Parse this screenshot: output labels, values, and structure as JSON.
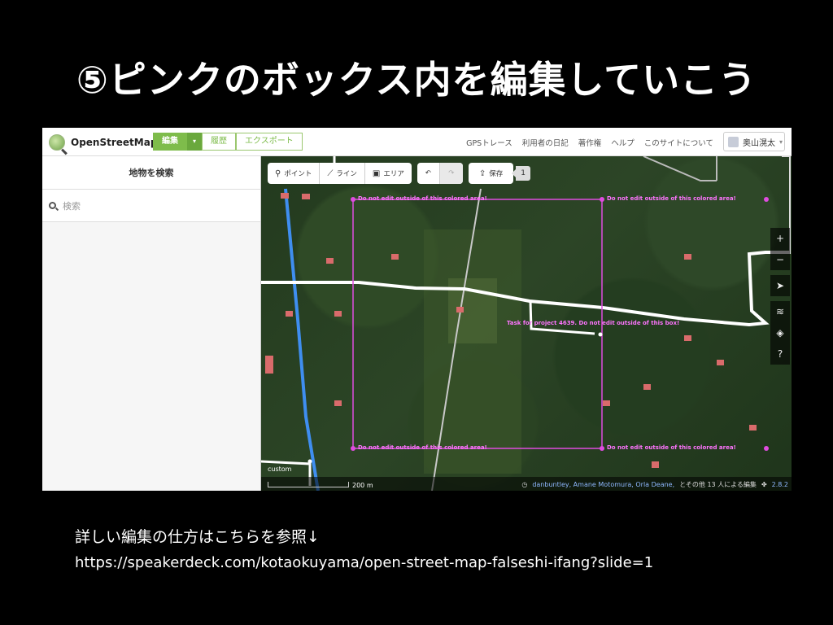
{
  "slide": {
    "title": "⑤ピンクのボックス内を編集していこう",
    "note": "詳しい編集の仕方はこちらを参照↓",
    "url": "https://speakerdeck.com/kotaokuyama/open-street-map-falseshi-ifang?slide=1"
  },
  "app": {
    "brand": "OpenStreetMap",
    "nav_tabs": [
      {
        "label": "編集",
        "active": true
      },
      {
        "label": "▾",
        "active": true
      },
      {
        "label": "履歴",
        "active": false
      },
      {
        "label": "エクスポート",
        "active": false
      }
    ],
    "nav_links": [
      "GPSトレース",
      "利用者の日記",
      "著作権",
      "ヘルプ",
      "このサイトについて"
    ],
    "user": "奥山滉太",
    "accent_color": "#7ebc4b"
  },
  "sidebar": {
    "header": "地物を検索",
    "search_placeholder": "検索"
  },
  "toolbar": {
    "point": "ポイント",
    "line": "ライン",
    "area": "エリア",
    "save": "保存",
    "save_count": "1"
  },
  "map": {
    "box_label": "Do not edit outside of this colored area!",
    "task_label": "Task for project 4639. Do not edit outside of this box!",
    "custom_label": "custom",
    "scale": "200 m",
    "attribution_names": "danbuntley, Amane Motomura, Orla Deane,",
    "attribution_rest": "とその他 13 人による編集",
    "version": "2.8.2",
    "box_color": "#e04ce0"
  },
  "map_controls": [
    "+",
    "−",
    "➤",
    "≋",
    "◈",
    "?"
  ]
}
